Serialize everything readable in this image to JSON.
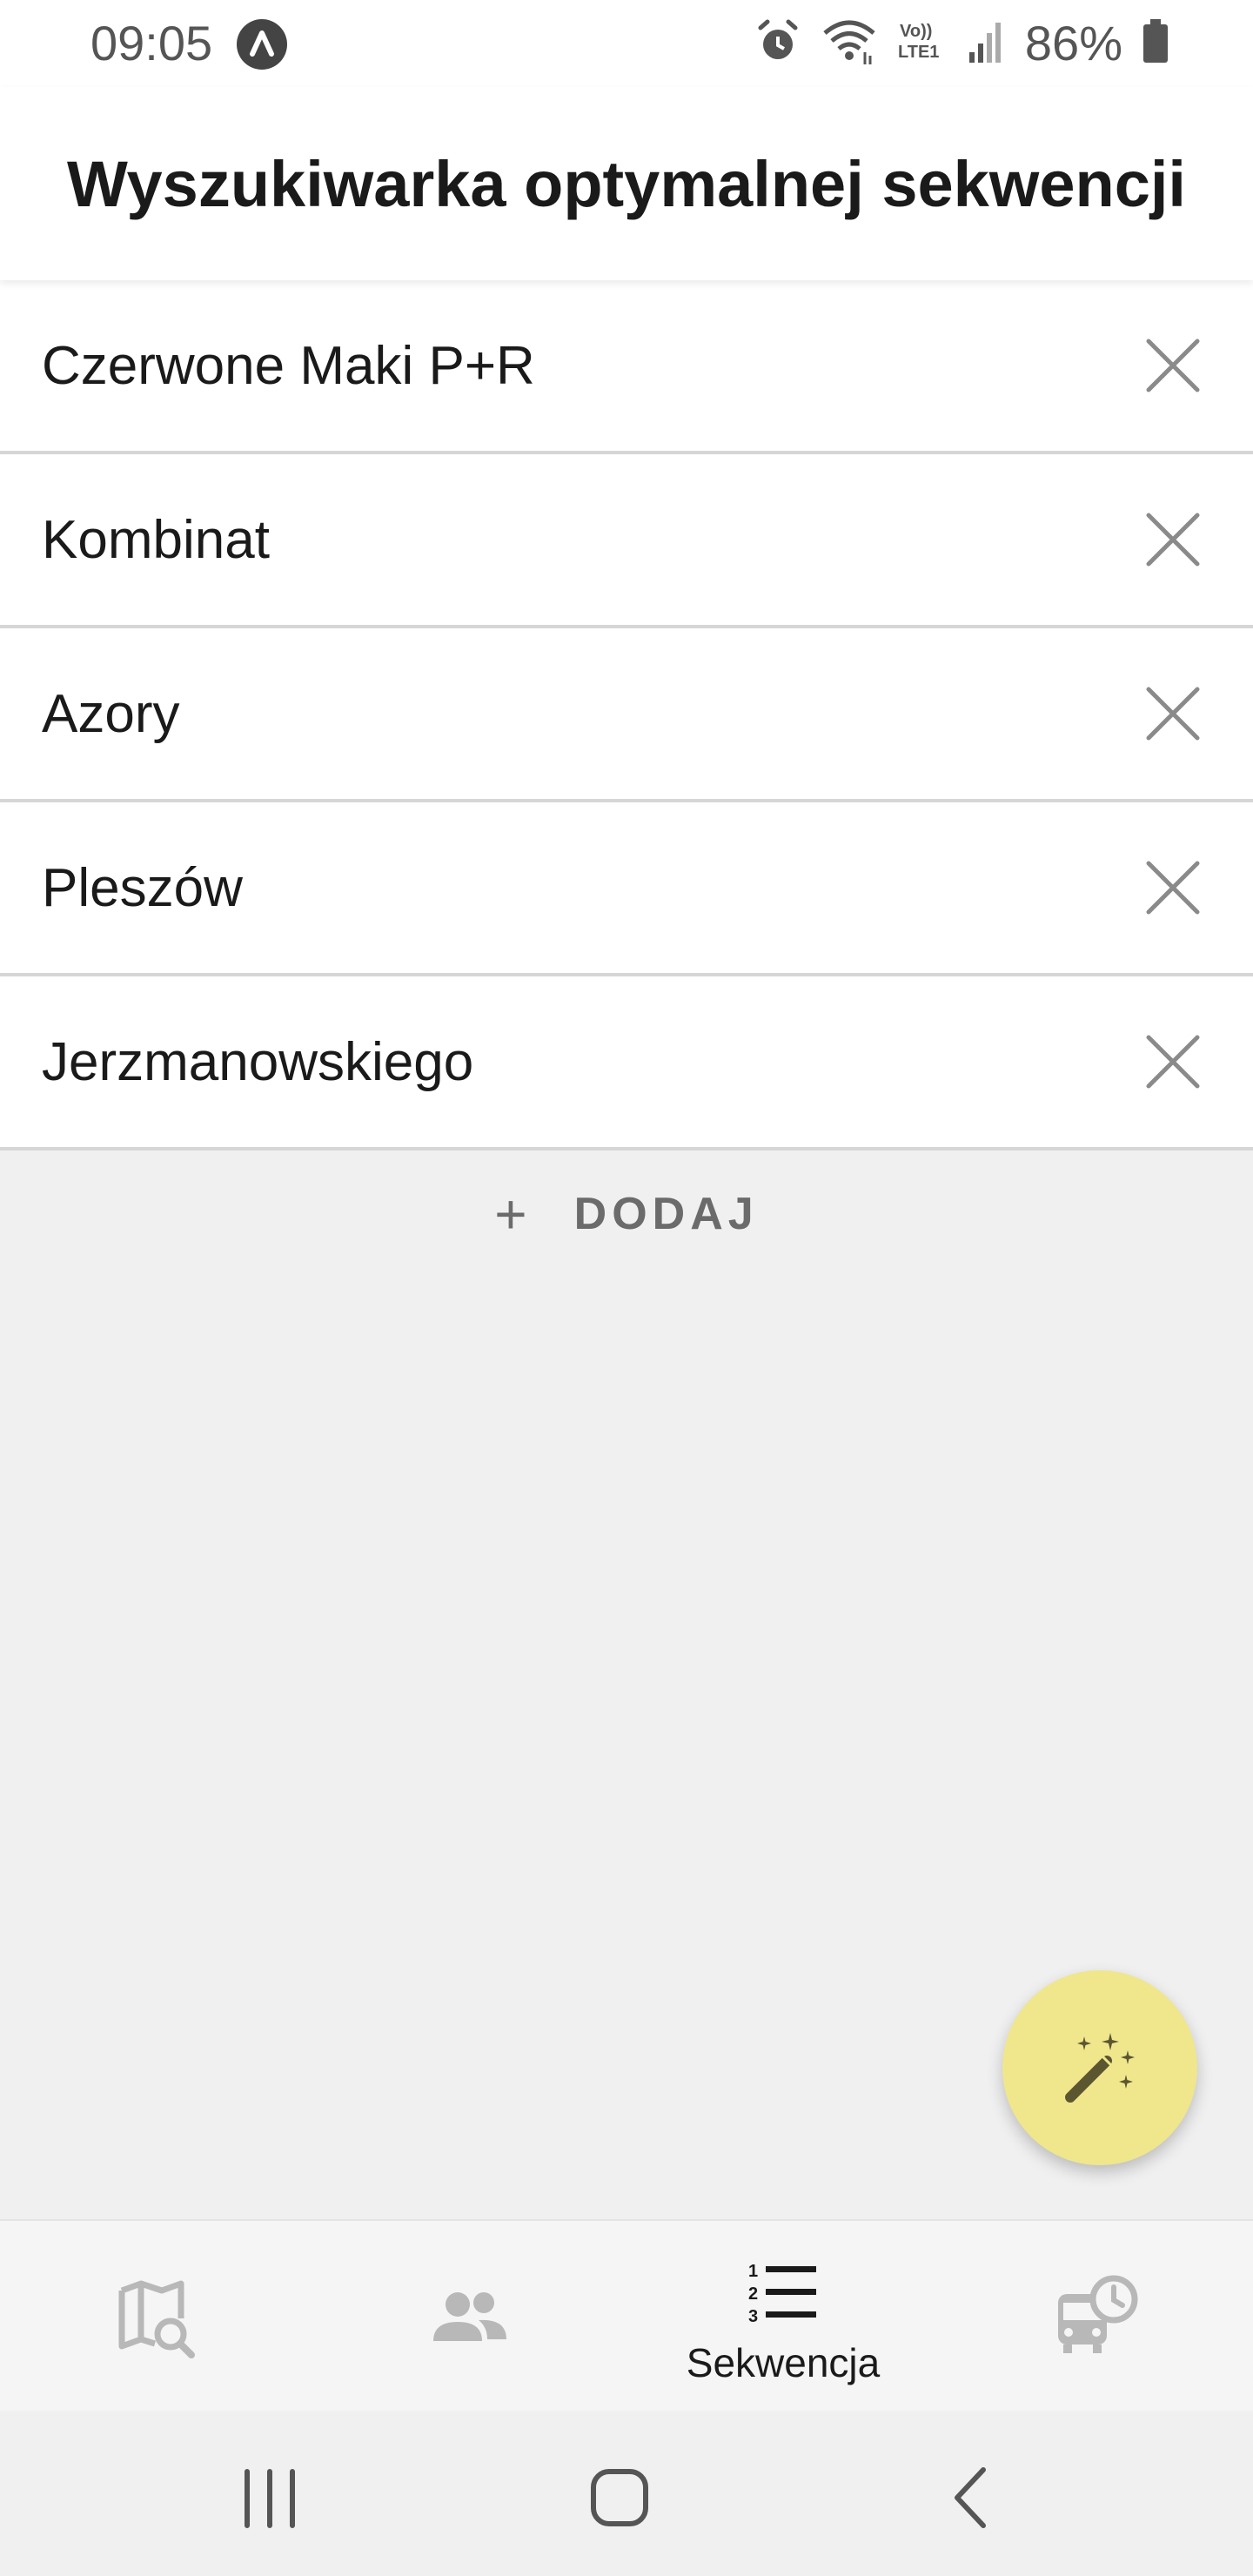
{
  "status_bar": {
    "time": "09:05",
    "battery": "86%",
    "icons": [
      "app-notification-icon",
      "alarm-icon",
      "wifi-icon",
      "volte-icon",
      "signal-icon",
      "battery-icon"
    ]
  },
  "header": {
    "title": "Wyszukiwarka optymalnej sekwencji"
  },
  "stops": [
    {
      "name": "Czerwone Maki P+R"
    },
    {
      "name": "Kombinat"
    },
    {
      "name": "Azory"
    },
    {
      "name": "Pleszów"
    },
    {
      "name": "Jerzmanowskiego"
    }
  ],
  "add_button": {
    "icon": "+",
    "label": "DODAJ"
  },
  "fab": {
    "icon": "magic-wand-icon",
    "color": "#f0e68c"
  },
  "bottom_nav": {
    "items": [
      {
        "icon": "map-search-icon",
        "label": ""
      },
      {
        "icon": "people-icon",
        "label": ""
      },
      {
        "icon": "sequence-list-icon",
        "label": "Sekwencja",
        "active": true
      },
      {
        "icon": "bus-schedule-icon",
        "label": ""
      }
    ]
  },
  "system_nav": {
    "buttons": [
      "recent-apps-icon",
      "home-icon",
      "back-icon"
    ]
  }
}
